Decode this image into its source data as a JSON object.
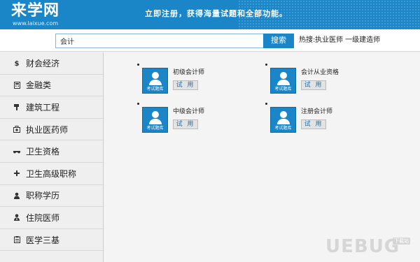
{
  "header": {
    "logo": "来学网",
    "logo_url": "www.laixue.com",
    "slogan": "立即注册，获得海量试题和全部功能。"
  },
  "search": {
    "value": "会计",
    "button_label": "搜索",
    "hot_label": "热搜:",
    "hot_links": "执业医师 一级建造师"
  },
  "sidebar": {
    "items": [
      {
        "label": "财会经济",
        "icon": "dollar-icon"
      },
      {
        "label": "金融类",
        "icon": "calculator-icon"
      },
      {
        "label": "建筑工程",
        "icon": "hammer-icon"
      },
      {
        "label": "执业医药师",
        "icon": "medkit-icon"
      },
      {
        "label": "卫生资格",
        "icon": "glasses-icon"
      },
      {
        "label": "卫生高级职称",
        "icon": "plus-icon"
      },
      {
        "label": "职称学历",
        "icon": "user-icon"
      },
      {
        "label": "住院医师",
        "icon": "doctor-icon"
      },
      {
        "label": "医学三基",
        "icon": "clipboard-icon"
      }
    ]
  },
  "courses": [
    {
      "title": "初级会计师",
      "thumb": "考试题库",
      "trial": "试 用"
    },
    {
      "title": "会计从业资格",
      "thumb": "考试题库",
      "trial": "试 用"
    },
    {
      "title": "中级会计师",
      "thumb": "考试题库",
      "trial": "试 用"
    },
    {
      "title": "注册会计师",
      "thumb": "考试题库",
      "trial": "试 用"
    }
  ],
  "watermark": {
    "text": "UEBUG",
    "badge": "下载站"
  },
  "colors": {
    "brand_blue": "#1a86c8",
    "sidebar_bg": "#efefef",
    "main_bg": "#f4f4f4"
  }
}
